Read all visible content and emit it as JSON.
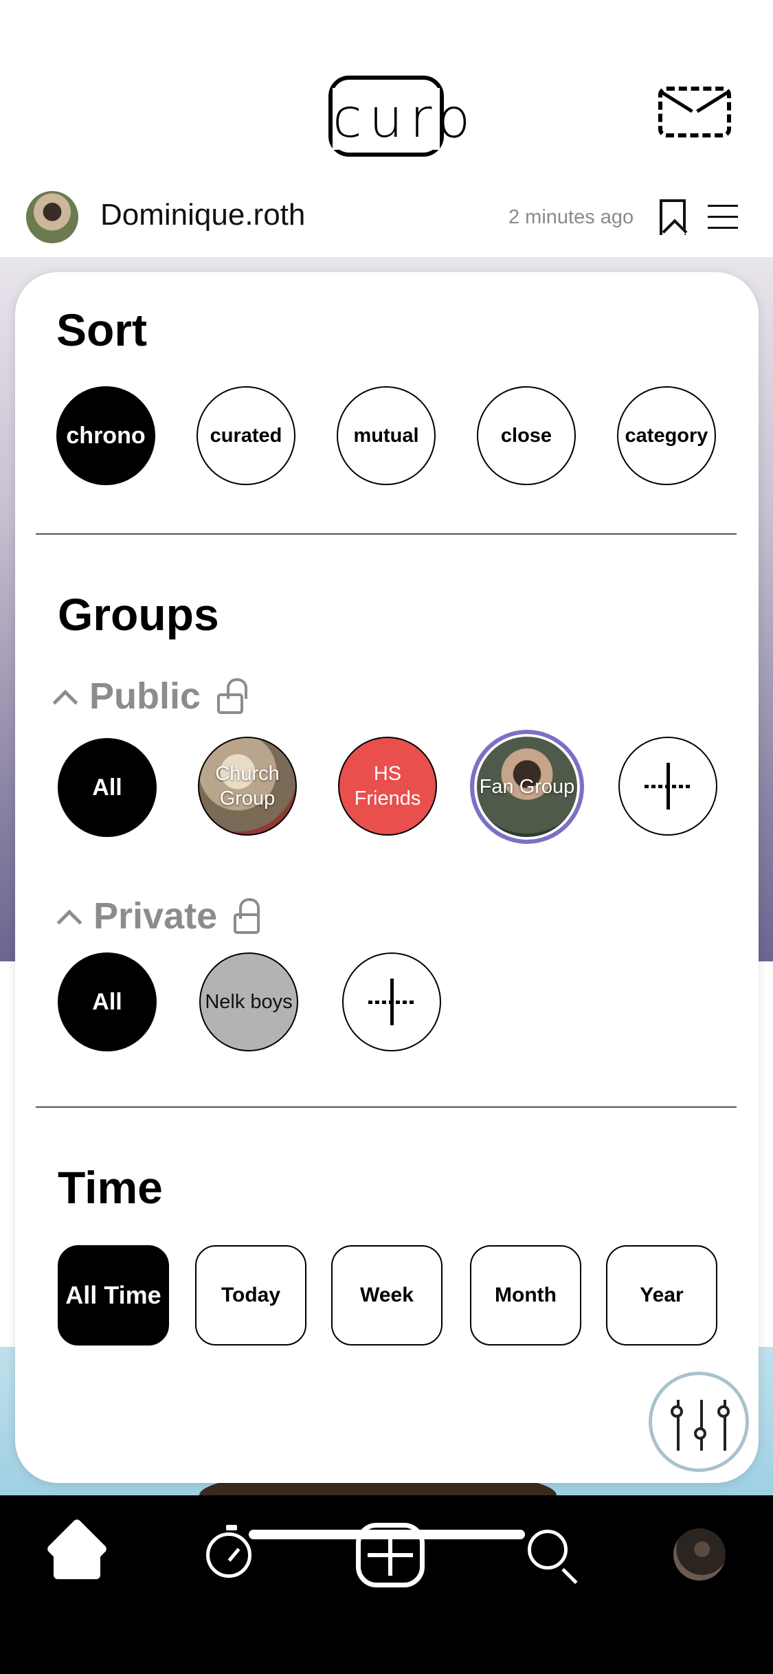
{
  "header": {
    "logo_text": "curo",
    "mail_icon": "mail-icon"
  },
  "post": {
    "username": "Dominique.roth",
    "time_ago": "2 minutes ago"
  },
  "sort": {
    "title": "Sort",
    "options": [
      "chrono",
      "curated",
      "mutual",
      "close",
      "category"
    ],
    "selected": "chrono"
  },
  "groups": {
    "title": "Groups",
    "public": {
      "label": "Public",
      "items": [
        "All",
        "Church Group",
        "HS Friends",
        "Fan Group"
      ],
      "selected": "All"
    },
    "private": {
      "label": "Private",
      "items": [
        "All",
        "Nelk boys"
      ],
      "selected": "All"
    }
  },
  "time": {
    "title": "Time",
    "options": [
      "All Time",
      "Today",
      "Week",
      "Month",
      "Year"
    ],
    "selected": "All Time"
  },
  "colors": {
    "accent_ring": "#7d6fc6",
    "hs_friends": "#e84f4d",
    "nelk_boys": "#b3b3b3",
    "fab_ring": "#a9c2cd"
  },
  "tabbar": {
    "icons": [
      "home-icon",
      "timer-icon",
      "create-icon",
      "search-icon",
      "profile-avatar"
    ]
  }
}
